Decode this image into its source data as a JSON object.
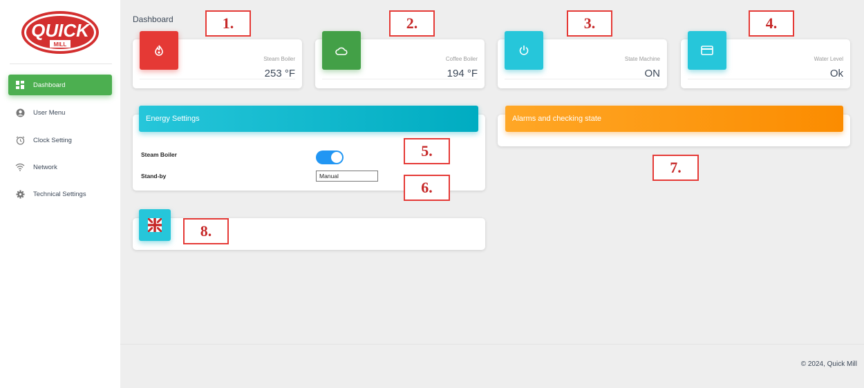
{
  "app": {
    "brand": "QUICK",
    "brand_sub": "MILL",
    "page_title": "Dashboard",
    "footer": "© 2024, Quick Mill"
  },
  "sidebar": {
    "items": [
      {
        "label": "Dashboard",
        "icon": "dashboard-icon",
        "active": true
      },
      {
        "label": "User Menu",
        "icon": "user-icon",
        "active": false
      },
      {
        "label": "Clock Setting",
        "icon": "alarm-clock-icon",
        "active": false
      },
      {
        "label": "Network",
        "icon": "wifi-icon",
        "active": false
      },
      {
        "label": "Technical Settings",
        "icon": "gear-icon",
        "active": false
      }
    ]
  },
  "stats": [
    {
      "label": "Steam Boiler",
      "value": "253 °F",
      "icon": "flame-icon",
      "color": "#e53935"
    },
    {
      "label": "Coffee Boiler",
      "value": "194 °F",
      "icon": "cloud-icon",
      "color": "#43a047"
    },
    {
      "label": "State Machine",
      "value": "ON",
      "icon": "power-icon",
      "color": "#00acc1"
    },
    {
      "label": "Water Level",
      "value": "Ok",
      "icon": "card-icon",
      "color": "#00acc1"
    }
  ],
  "energy": {
    "title": "Energy Settings",
    "steam_boiler_label": "Steam Boiler",
    "steam_boiler_on": true,
    "standby_label": "Stand-by",
    "standby_value": "Manual"
  },
  "alarms": {
    "title": "Alarms and checking state"
  },
  "language": {
    "icon": "uk-flag-icon"
  },
  "callouts": [
    "1.",
    "2.",
    "3.",
    "4.",
    "5.",
    "6.",
    "7.",
    "8."
  ],
  "colors": {
    "accent_green": "#4caf50",
    "accent_cyan": "#00acc1",
    "accent_orange": "#fb8c00",
    "accent_red": "#e53935",
    "toggle_blue": "#2196f3",
    "callout_red": "#e53935"
  }
}
